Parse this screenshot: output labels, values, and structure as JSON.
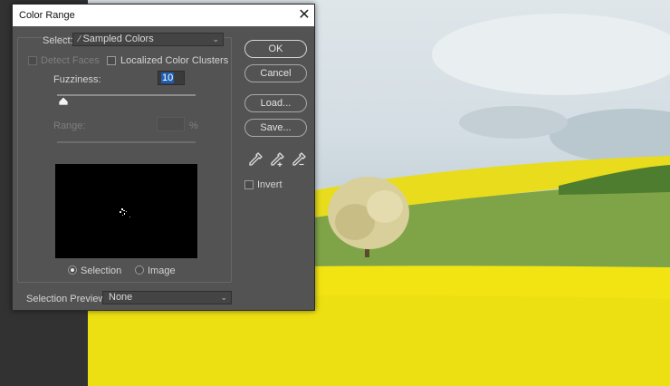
{
  "dialog": {
    "title": "Color Range",
    "select_label": "Select:",
    "select_value": "Sampled Colors",
    "detect_faces_label": "Detect Faces",
    "localized_label": "Localized Color Clusters",
    "fuzziness_label": "Fuzziness:",
    "fuzziness_value": "10",
    "range_label": "Range:",
    "range_unit": "%",
    "radio_selection_label": "Selection",
    "radio_image_label": "Image",
    "radio_selected": "Selection",
    "preview_mode_label": "Selection Preview:",
    "preview_mode_value": "None",
    "invert_label": "Invert",
    "buttons": {
      "ok": "OK",
      "cancel": "Cancel",
      "load": "Load...",
      "save": "Save..."
    },
    "icons": {
      "close": "close-icon",
      "dropdown": "chevron-down-icon",
      "select_icon": "eyedropper-icon",
      "tools": [
        "eyedropper-icon",
        "eyedropper-plus-icon",
        "eyedropper-minus-icon"
      ]
    },
    "colors": {
      "dialog_bg": "#535353",
      "titlebar_bg": "#ffffff",
      "field_highlight": "#1f5fb3"
    }
  }
}
